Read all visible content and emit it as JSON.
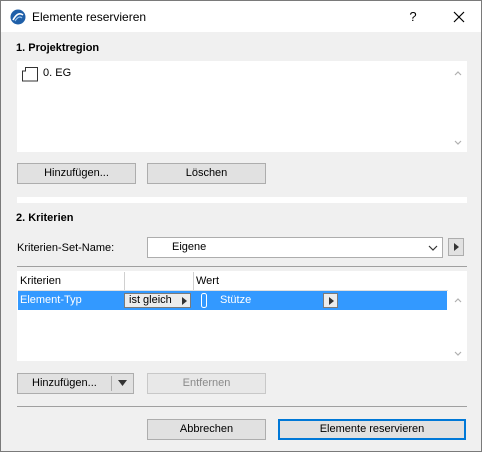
{
  "window": {
    "title": "Elemente reservieren",
    "help_label": "?"
  },
  "projektregion": {
    "heading": "1. Projektregion",
    "items": [
      {
        "label": "0. EG",
        "icon": "story-icon"
      }
    ],
    "add_label": "Hinzufügen...",
    "delete_label": "Löschen"
  },
  "kriterien": {
    "heading": "2. Kriterien",
    "set_name_label": "Kriterien-Set-Name:",
    "set_name_value": "Eigene",
    "table": {
      "columns": [
        "Kriterien",
        "",
        "Wert"
      ],
      "rows": [
        {
          "criterion": "Element-Typ",
          "operator": "ist gleich",
          "value": "Stütze",
          "value_icon": "column-icon"
        }
      ]
    },
    "add_label": "Hinzufügen...",
    "remove_label": "Entfernen"
  },
  "footer": {
    "cancel_label": "Abbrechen",
    "confirm_label": "Elemente reservieren"
  },
  "colors": {
    "selection": "#3399ff",
    "accent": "#0078d7",
    "background": "#f0f0f0"
  }
}
